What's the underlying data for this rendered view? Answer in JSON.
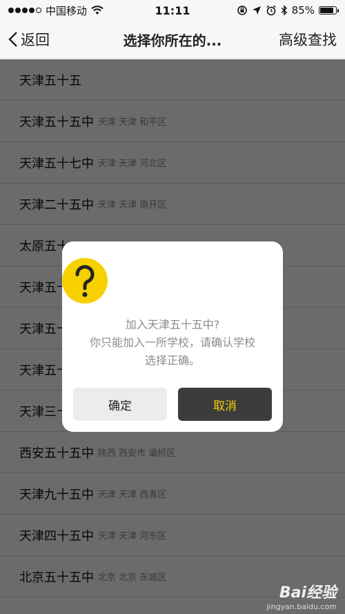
{
  "status_bar": {
    "carrier": "中国移动",
    "time": "11:11",
    "battery": "85%",
    "battery_level": 0.85
  },
  "nav": {
    "back_label": "返回",
    "title": "选择你所在的...",
    "right_label": "高级查找"
  },
  "schools": [
    {
      "name": "天津五十五",
      "location": ""
    },
    {
      "name": "天津五十五中",
      "location": "天津 天津 和平区"
    },
    {
      "name": "天津五十七中",
      "location": "天津 天津 河北区"
    },
    {
      "name": "天津二十五中",
      "location": "天津 天津 南开区"
    },
    {
      "name": "太原五十",
      "location": ""
    },
    {
      "name": "天津五十",
      "location": ""
    },
    {
      "name": "天津五十",
      "location": ""
    },
    {
      "name": "天津五十",
      "location": ""
    },
    {
      "name": "天津三十",
      "location": ""
    },
    {
      "name": "西安五十五中",
      "location": "陕西 西安市 灞桥区"
    },
    {
      "name": "天津九十五中",
      "location": "天津 天津 西青区"
    },
    {
      "name": "天津四十五中",
      "location": "天津 天津 河东区"
    },
    {
      "name": "北京五十五中",
      "location": "北京 北京 东城区"
    }
  ],
  "dialog": {
    "icon": "question-icon",
    "line1": "加入天津五十五中?",
    "line2": "你只能加入一所学校，请确认学校",
    "line3": "选择正确。",
    "confirm_label": "确定",
    "cancel_label": "取消"
  },
  "watermark": {
    "logo": "Bai经验",
    "url": "jingyan.baidu.com"
  },
  "colors": {
    "accent_yellow": "#f7d000",
    "cancel_bg": "#3c3c3c",
    "confirm_bg": "#ececec"
  }
}
